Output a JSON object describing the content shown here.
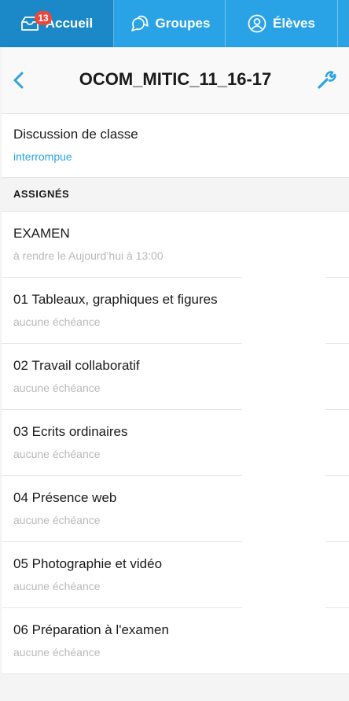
{
  "tabs": {
    "accueil": {
      "label": "Accueil",
      "badge": "13"
    },
    "groupes": {
      "label": "Groupes"
    },
    "eleves": {
      "label": "Élèves"
    }
  },
  "header": {
    "title": "OCOM_MITIC_11_16-17",
    "back_icon": "chevron-left-icon",
    "settings_icon": "wrench-icon"
  },
  "discussion": {
    "title": "Discussion de classe",
    "status": "interrompue"
  },
  "section": {
    "title": "ASSIGNÉS"
  },
  "assignments": [
    {
      "title": "EXAMEN",
      "due": "à rendre le Aujourd’hui à 13:00"
    },
    {
      "title": "01 Tableaux, graphiques et figures",
      "due": "aucune échéance"
    },
    {
      "title": "02 Travail collaboratif",
      "due": "aucune échéance"
    },
    {
      "title": "03 Ecrits ordinaires",
      "due": "aucune échéance"
    },
    {
      "title": "04 Présence web",
      "due": "aucune échéance"
    },
    {
      "title": "05 Photographie et vidéo",
      "due": "aucune échéance"
    },
    {
      "title": "06 Préparation à l'examen",
      "due": "aucune échéance"
    }
  ],
  "colors": {
    "accent": "#2aa3e6",
    "tab_active": "#1b88c8",
    "badge": "#e8473c"
  }
}
